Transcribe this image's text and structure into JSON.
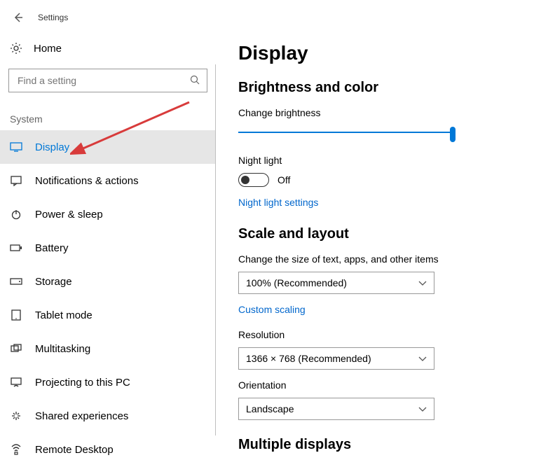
{
  "window": {
    "title": "Settings"
  },
  "sidebar": {
    "home_label": "Home",
    "search_placeholder": "Find a setting",
    "group_label": "System",
    "items": [
      {
        "label": "Display"
      },
      {
        "label": "Notifications & actions"
      },
      {
        "label": "Power & sleep"
      },
      {
        "label": "Battery"
      },
      {
        "label": "Storage"
      },
      {
        "label": "Tablet mode"
      },
      {
        "label": "Multitasking"
      },
      {
        "label": "Projecting to this PC"
      },
      {
        "label": "Shared experiences"
      },
      {
        "label": "Remote Desktop"
      }
    ]
  },
  "main": {
    "page_title": "Display",
    "brightness": {
      "section_title": "Brightness and color",
      "slider_label": "Change brightness",
      "slider_value": 100,
      "nightlight_label": "Night light",
      "nightlight_state": "Off",
      "nightlight_link": "Night light settings"
    },
    "scale": {
      "section_title": "Scale and layout",
      "scale_label": "Change the size of text, apps, and other items",
      "scale_value": "100% (Recommended)",
      "custom_link": "Custom scaling",
      "resolution_label": "Resolution",
      "resolution_value": "1366 × 768 (Recommended)",
      "orientation_label": "Orientation",
      "orientation_value": "Landscape"
    },
    "multiple": {
      "section_title": "Multiple displays"
    }
  }
}
